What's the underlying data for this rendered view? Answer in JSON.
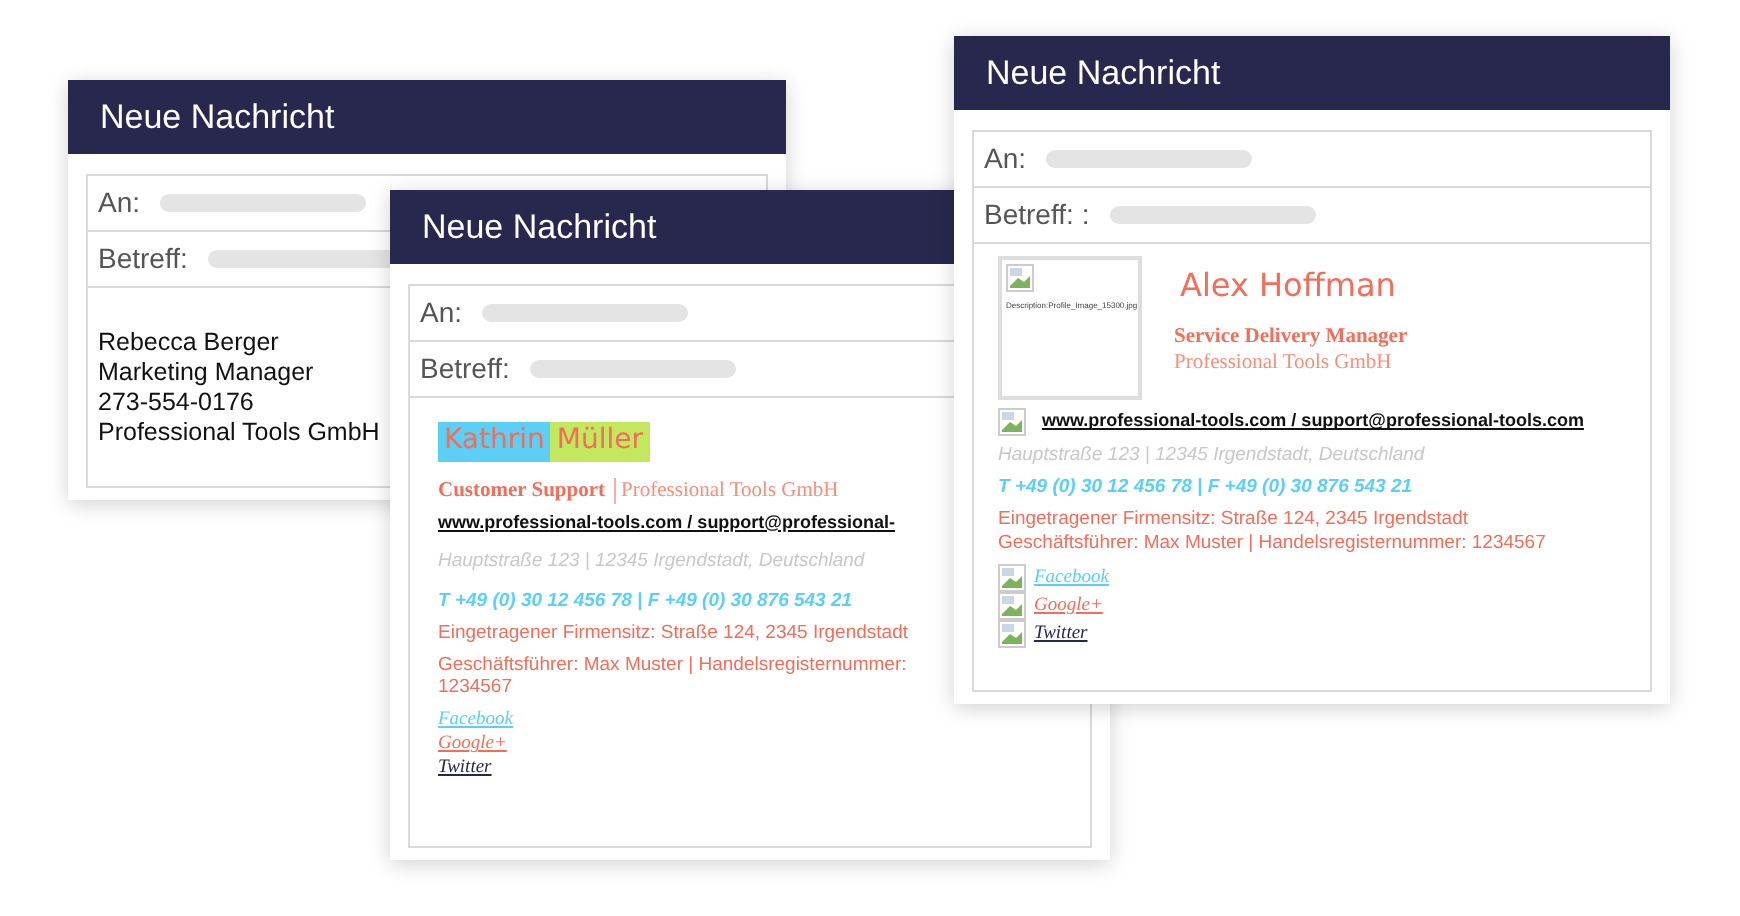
{
  "windows": [
    {
      "title": "Neue Nachricht",
      "fields": [
        {
          "label": "An:"
        },
        {
          "label": "Betreff:"
        }
      ],
      "signature": {
        "kind": "plain",
        "lines": [
          "Rebecca Berger",
          "Marketing Manager",
          "273-554-0176",
          "Professional Tools GmbH"
        ]
      }
    },
    {
      "title": "Neue Nachricht",
      "fields": [
        {
          "label": "An:"
        },
        {
          "label": "Betreff:"
        }
      ],
      "signature": {
        "kind": "styled",
        "name_parts": [
          {
            "text": "Kathrin",
            "color": "#5bcff5"
          },
          {
            "text": "Müller",
            "color": "#c3e85d"
          }
        ],
        "role": "Customer Support",
        "company": "Professional Tools GmbH",
        "web": "www.professional-tools.com / support@professional-",
        "address": "Hauptstraße 123 | 12345 Irgendstadt, Deutschland",
        "phone": "T +49 (0) 30 12 456 78 | F +49 (0) 30 876 543 21",
        "seat": "Eingetragener Firmensitz: Straße 124, 2345 Irgendstadt",
        "manager": "Geschäftsführer: Max Muster | Handelsregisternummer: 1234567",
        "socials": [
          {
            "label": "Facebook",
            "color": "#5bcff5"
          },
          {
            "label": "Google+",
            "color": "#f06e5a"
          },
          {
            "label": "Twitter",
            "color": "#28284e"
          }
        ]
      }
    },
    {
      "title": "Neue Nachricht",
      "fields": [
        {
          "label": "An:"
        },
        {
          "label": "Betreff:",
          "prefix": ":"
        }
      ],
      "signature": {
        "kind": "photo",
        "photo_alt": "Description:Profile_Image_15300.jpg",
        "name": "Alex Hoffman",
        "role": "Service Delivery Manager",
        "company": "Professional Tools GmbH",
        "web": "www.professional-tools.com / support@professional-tools.com",
        "address": "Hauptstraße 123 | 12345 Irgendstadt, Deutschland",
        "phone": "T +49 (0) 30 12 456 78 | F +49 (0) 30 876 543 21",
        "seat": "Eingetragener Firmensitz: Straße 124, 2345 Irgendstadt",
        "manager": "Geschäftsführer: Max Muster | Handelsregisternummer: 1234567",
        "socials": [
          {
            "label": "Facebook",
            "color": "#5bcff5"
          },
          {
            "label": "Google+",
            "color": "#f06e5a"
          },
          {
            "label": "Twitter",
            "color": "#28284e"
          }
        ]
      }
    }
  ]
}
